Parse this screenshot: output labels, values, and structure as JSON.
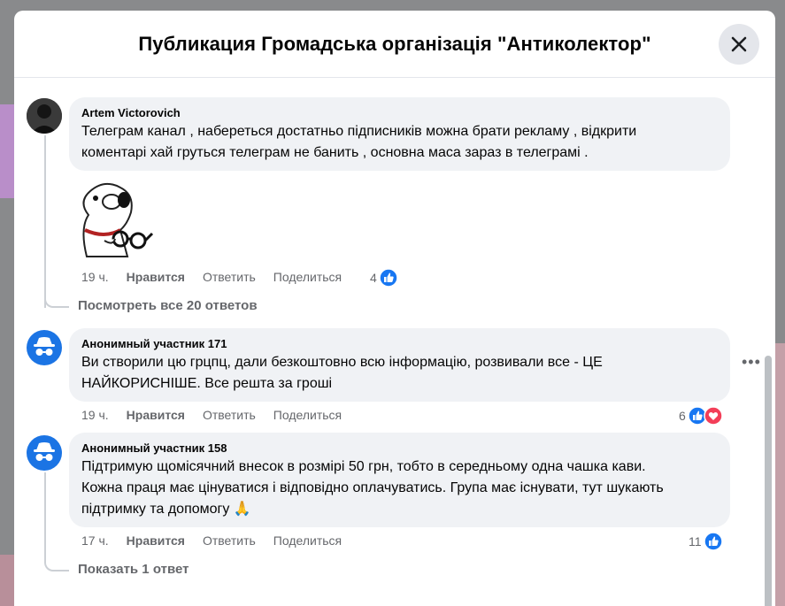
{
  "modal": {
    "title": "Публикация Громадська організація \"Антиколектор\""
  },
  "comments": [
    {
      "author": "Artem Victorovich",
      "lines": [
        "Телеграм канал , набереться достатньо підписників можна брати рекламу , відкрити",
        "коментарі хай груться телеграм не банить , основна маса зараз в телеграмі ."
      ],
      "time": "19 ч.",
      "like_label": "Нравится",
      "reply_label": "Ответить",
      "share_label": "Поделиться",
      "reaction_count": "4",
      "avatar_icon": "user-photo",
      "sticker_icon": "cartoon-dog-with-glasses-sticker"
    },
    {
      "author": "Анонимный участник 171",
      "lines": [
        "Ви створили цю грцпц, дали безкоштовно всю інформацію, розвивали все - ЦЕ",
        "НАЙКОРИСНІШЕ. Все решта за гроші"
      ],
      "time": "19 ч.",
      "like_label": "Нравится",
      "reply_label": "Ответить",
      "share_label": "Поделиться",
      "reaction_count": "6",
      "avatar_icon": "anonymous-icon"
    },
    {
      "author": "Анонимный участник 158",
      "lines": [
        "Підтримую щомісячний внесок в розмірі 50 грн, тобто в середньому одна чашка кави.",
        "Кожна праця має цінуватися і відповідно оплачуватись. Група має існувати, тут шукають",
        "підтримку та допомогу 🙏"
      ],
      "time": "17 ч.",
      "like_label": "Нравится",
      "reply_label": "Ответить",
      "share_label": "Поделиться",
      "reaction_count": "11",
      "avatar_icon": "anonymous-icon"
    }
  ],
  "view_all_replies": "Посмотреть все 20 ответов",
  "show_one_reply": "Показать 1 ответ",
  "colors": {
    "like_blue": "#1877f2",
    "love_red": "#f33e58",
    "anon_avatar_bg": "#1b74e4",
    "bubble_bg": "#f0f2f5"
  }
}
